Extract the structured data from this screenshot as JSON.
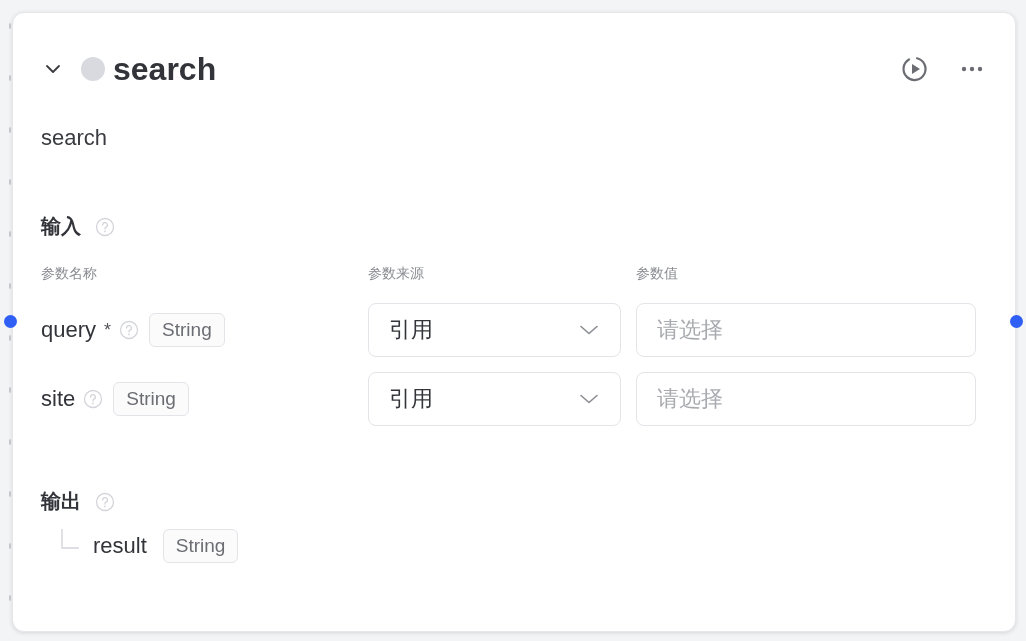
{
  "node": {
    "title": "search",
    "expanded": true,
    "description": "search"
  },
  "inputs": {
    "heading": "输入",
    "columns": [
      "参数名称",
      "参数来源",
      "参数值"
    ],
    "rows": [
      {
        "name": "query",
        "required": true,
        "required_mark": "*",
        "type": "String",
        "source": "引用",
        "placeholder": "请选择"
      },
      {
        "name": "site",
        "required": false,
        "type": "String",
        "source": "引用",
        "placeholder": "请选择"
      }
    ]
  },
  "outputs": {
    "heading": "输出",
    "items": [
      {
        "name": "result",
        "type": "String"
      }
    ]
  }
}
